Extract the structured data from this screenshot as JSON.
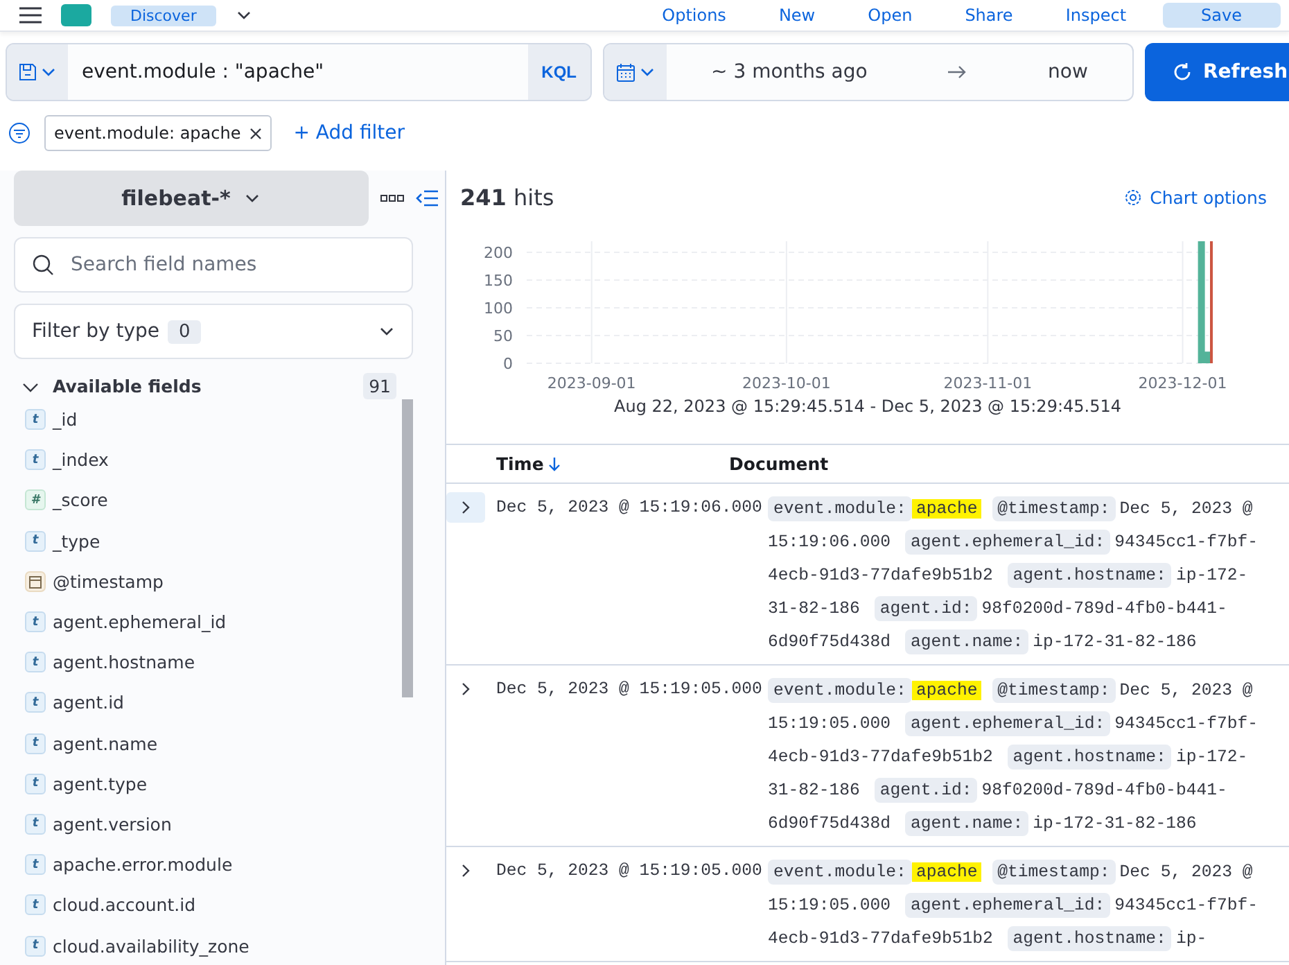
{
  "top_nav": {
    "app_badge": "Discover",
    "links": [
      "Options",
      "New",
      "Open",
      "Share",
      "Inspect"
    ],
    "save_button": "Save"
  },
  "query_bar": {
    "query": "event.module : \"apache\"",
    "language": "KQL",
    "start": "~ 3 months ago",
    "end": "now",
    "refresh_button": "Refresh"
  },
  "filters": [
    {
      "label": "event.module: apache"
    }
  ],
  "add_filter": "+ Add filter",
  "sidebar": {
    "index_pattern": "filebeat-*",
    "search": {
      "placeholder": "Search field names"
    },
    "filter_by_type": {
      "label": "Filter by type",
      "count": "0"
    },
    "section": {
      "title": "Available fields",
      "count": "91",
      "expanded": true
    },
    "fields": [
      {
        "name": "_id",
        "kind": "string",
        "icon_text": "t"
      },
      {
        "name": "_index",
        "kind": "string",
        "icon_text": "t"
      },
      {
        "name": "_score",
        "kind": "number",
        "icon_text": "#"
      },
      {
        "name": "_type",
        "kind": "string",
        "icon_text": "t"
      },
      {
        "name": "@timestamp",
        "kind": "date"
      },
      {
        "name": "agent.ephemeral_id",
        "kind": "string",
        "icon_text": "t"
      },
      {
        "name": "agent.hostname",
        "kind": "string",
        "icon_text": "t"
      },
      {
        "name": "agent.id",
        "kind": "string",
        "icon_text": "t"
      },
      {
        "name": "agent.name",
        "kind": "string",
        "icon_text": "t"
      },
      {
        "name": "agent.type",
        "kind": "string",
        "icon_text": "t"
      },
      {
        "name": "agent.version",
        "kind": "string",
        "icon_text": "t"
      },
      {
        "name": "apache.error.module",
        "kind": "string",
        "icon_text": "t"
      },
      {
        "name": "cloud.account.id",
        "kind": "string",
        "icon_text": "t"
      },
      {
        "name": "cloud.availability_zone",
        "kind": "string",
        "icon_text": "t"
      }
    ]
  },
  "hits": {
    "count": "241",
    "label": "hits",
    "chart_options": "Chart options",
    "range": "Aug 22, 2023 @ 15:29:45.514 - Dec 5, 2023 @ 15:29:45.514",
    "chart_data": {
      "type": "bar",
      "grid": true,
      "x": [
        "2023-12-04",
        "2023-12-05"
      ],
      "values": [
        220,
        21
      ],
      "ylim": [
        0,
        220
      ],
      "yticks": [
        0,
        50,
        100,
        150,
        200
      ],
      "xlim": [
        "2023-08-22",
        "2023-12-05"
      ],
      "xticks": [
        {
          "value": "2023-09-01",
          "label": "2023-09-01"
        },
        {
          "value": "2023-10-01",
          "label": "2023-10-01"
        },
        {
          "value": "2023-11-01",
          "label": "2023-11-01"
        },
        {
          "value": "2023-12-01",
          "label": "2023-12-01"
        }
      ]
    }
  },
  "table": {
    "columns": [
      {
        "label": "Time",
        "sorted": true
      },
      {
        "label": "Document",
        "sorted": false
      }
    ],
    "rows": [
      {
        "time": "Dec 5, 2023 @ 15:19:06.000",
        "expanded": false,
        "focused": true,
        "fields": [
          {
            "key": "event.module:",
            "value": "apache",
            "highlight": true
          },
          {
            "key": "@timestamp:",
            "value": "Dec 5, 2023 @ 15:19:06.000",
            "highlight": false
          },
          {
            "key": "agent.ephemeral_id:",
            "value": "94345cc1-f7bf-4ecb-91d3-77dafe9b51b2",
            "highlight": false
          },
          {
            "key": "agent.hostname:",
            "value": "ip-172-31-82-186",
            "highlight": false
          },
          {
            "key": "agent.id:",
            "value": "98f0200d-789d-4fb0-b441-6d90f75d438d",
            "highlight": false
          },
          {
            "key": "agent.name:",
            "value": "ip-172-31-82-186",
            "highlight": false
          }
        ]
      },
      {
        "time": "Dec 5, 2023 @ 15:19:05.000",
        "expanded": false,
        "focused": false,
        "fields": [
          {
            "key": "event.module:",
            "value": "apache",
            "highlight": true
          },
          {
            "key": "@timestamp:",
            "value": "Dec 5, 2023 @ 15:19:05.000",
            "highlight": false
          },
          {
            "key": "agent.ephemeral_id:",
            "value": "94345cc1-f7bf-4ecb-91d3-77dafe9b51b2",
            "highlight": false
          },
          {
            "key": "agent.hostname:",
            "value": "ip-172-31-82-186",
            "highlight": false
          },
          {
            "key": "agent.id:",
            "value": "98f0200d-789d-4fb0-b441-6d90f75d438d",
            "highlight": false
          },
          {
            "key": "agent.name:",
            "value": "ip-172-31-82-186",
            "highlight": false
          }
        ]
      },
      {
        "time": "Dec 5, 2023 @ 15:19:05.000",
        "expanded": false,
        "focused": false,
        "fields": [
          {
            "key": "event.module:",
            "value": "apache",
            "highlight": true
          },
          {
            "key": "@timestamp:",
            "value": "Dec 5, 2023 @ 15:19:05.000",
            "highlight": false
          },
          {
            "key": "agent.ephemeral_id:",
            "value": "94345cc1-f7bf-4ecb-91d3-77dafe9b51b2",
            "highlight": false
          },
          {
            "key": "agent.hostname:",
            "value": "ip-",
            "highlight": false
          }
        ]
      }
    ]
  }
}
